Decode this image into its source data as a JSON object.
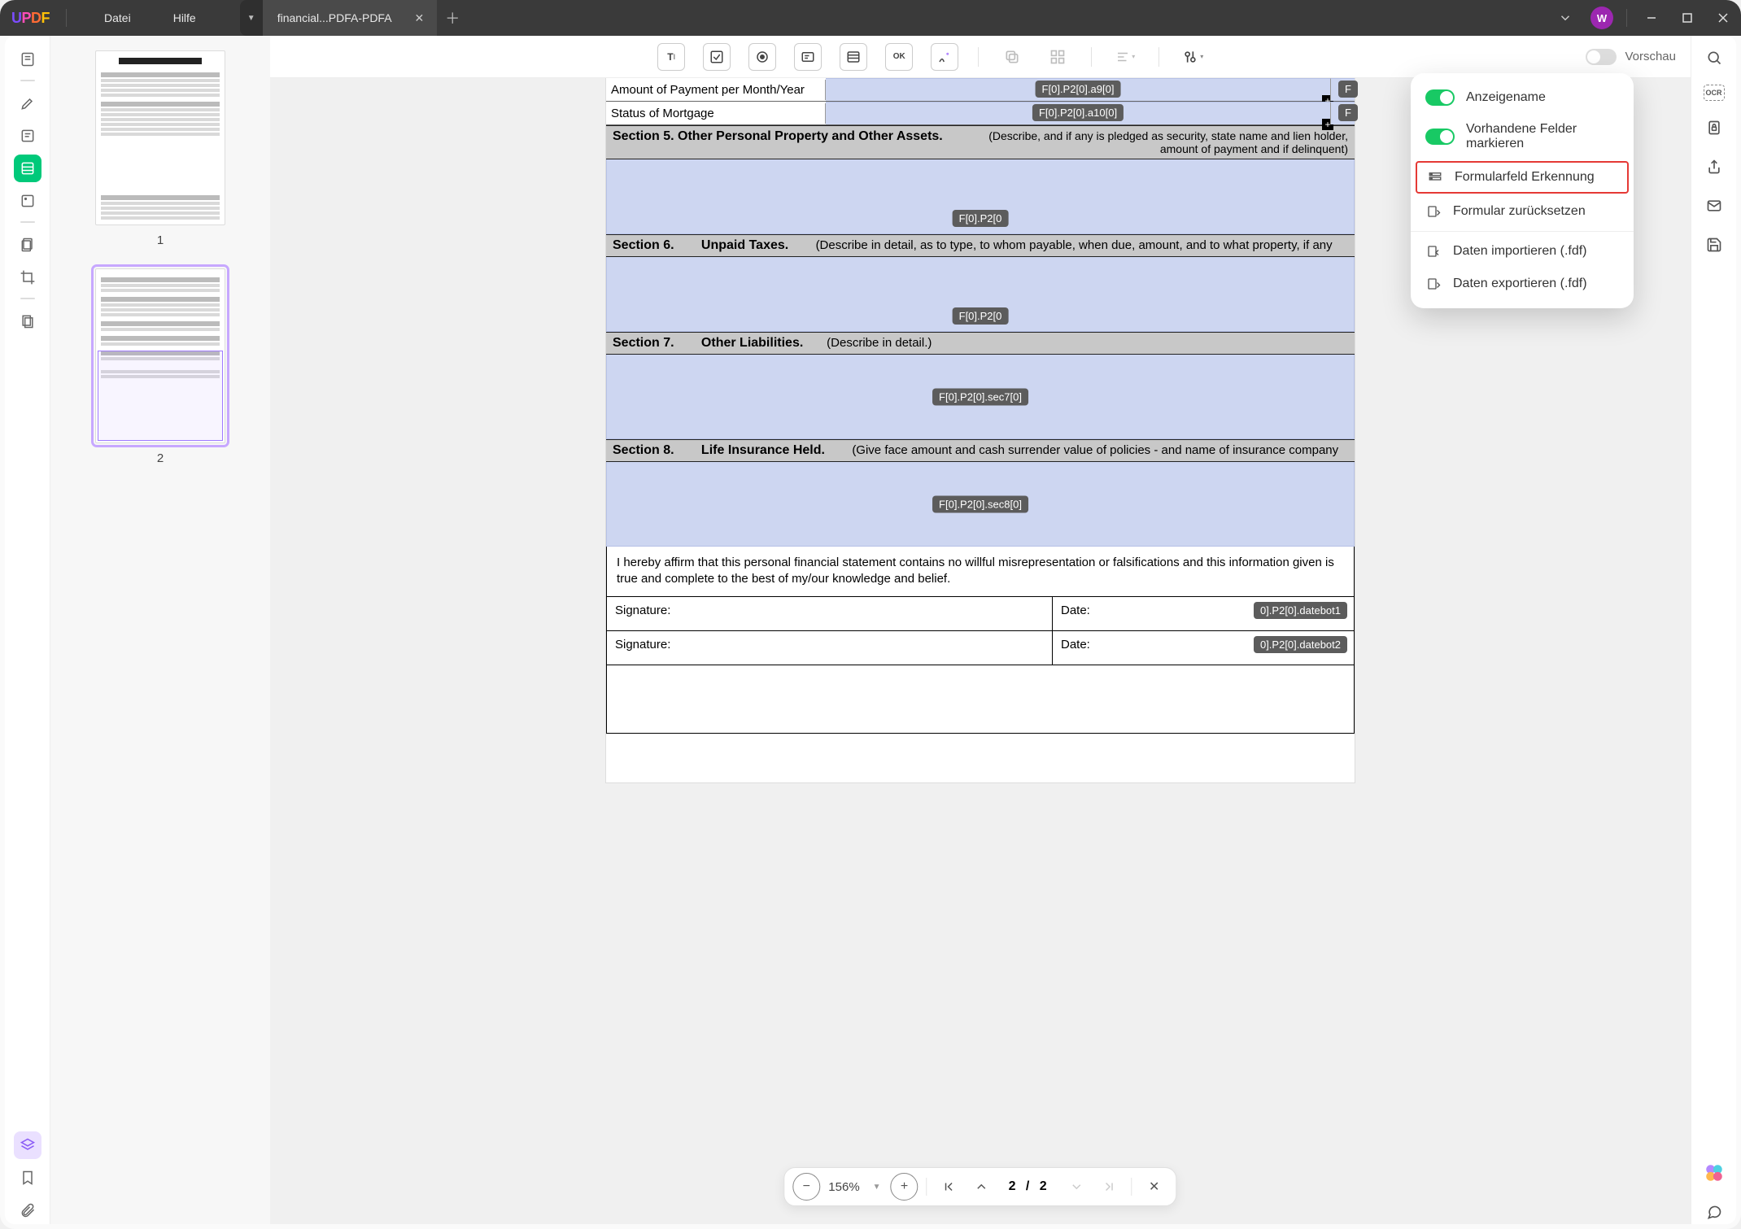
{
  "titlebar": {
    "menu_file": "Datei",
    "menu_help": "Hilfe",
    "tab_label": "financial...PDFA-PDFA",
    "avatar_initial": "W"
  },
  "toolbar": {
    "preview_label": "Vorschau"
  },
  "gear_menu": {
    "display_name": "Anzeigename",
    "highlight_existing": "Vorhandene Felder markieren",
    "recognize": "Formularfeld Erkennung",
    "reset": "Formular zurücksetzen",
    "import": "Daten importieren (.fdf)",
    "export": "Daten exportieren (.fdf)"
  },
  "thumbs": {
    "page1": "1",
    "page2": "2"
  },
  "doc": {
    "row_amount": "Amount of Payment per Month/Year",
    "row_status": "Status of Mortgage",
    "tag_a9": "F[0].P2[0].a9[0]",
    "tag_a10": "F[0].P2[0].a10[0]",
    "tag_f": "F",
    "sec5_title": "Section 5.  Other Personal Property and Other Assets.",
    "sec5_desc": "(Describe, and if any is pledged as security, state name and lien holder, amount of payment and if delinquent)",
    "sec5_tag": "F[0].P2[0",
    "sec6_title_a": "Section 6.",
    "sec6_title_b": "Unpaid Taxes.",
    "sec6_desc": "(Describe in detail, as to type, to whom payable, when due, amount, and to what property, if any",
    "sec6_tag": "F[0].P2[0",
    "sec7_title_a": "Section 7.",
    "sec7_title_b": "Other Liabilities.",
    "sec7_desc": "(Describe in detail.)",
    "sec7_tag": "F[0].P2[0].sec7[0]",
    "sec8_title_a": "Section 8.",
    "sec8_title_b": "Life Insurance Held.",
    "sec8_desc": "(Give face amount and cash surrender value of policies - and name of insurance company",
    "sec8_tag": "F[0].P2[0].sec8[0]",
    "affirm": "I hereby affirm that this personal financial statement contains no willful misrepresentation or falsifications and this information given is true and complete to the best of my/our knowledge and belief.",
    "signature": "Signature:",
    "date": "Date:",
    "datebot1": "0].P2[0].datebot1",
    "datebot2": "0].P2[0].datebot2"
  },
  "bottom": {
    "zoom": "156%",
    "page": "2 / 2"
  },
  "right_rail": {
    "ocr_label": "OCR"
  }
}
